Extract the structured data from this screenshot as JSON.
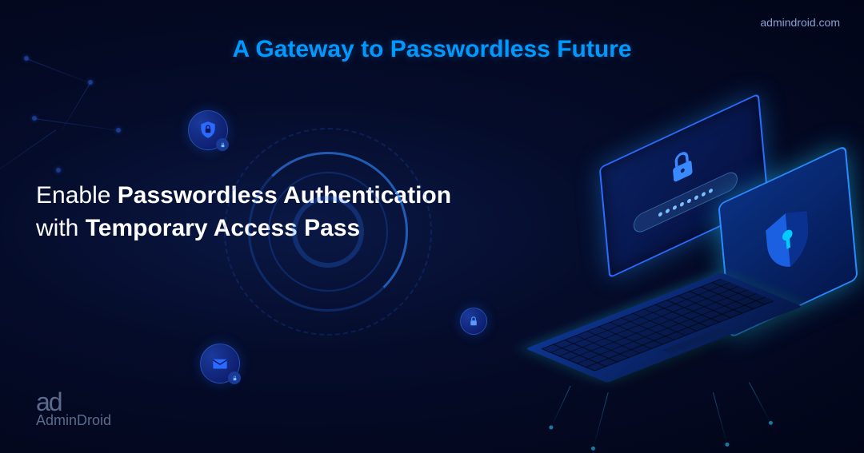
{
  "brand": {
    "url": "admindroid.com",
    "name": "AdminDroid",
    "glyph": "ad"
  },
  "tagline": "A Gateway to Passwordless Future",
  "headline": {
    "line1_pre": "Enable ",
    "line1_strong": "Passwordless Authentication",
    "line2_pre": "with ",
    "line2_strong": "Temporary Access Pass"
  },
  "icons": {
    "shield_lock": "shield with lock",
    "envelope_lock": "envelope with lock",
    "lock": "padlock",
    "shield_key": "shield with keyhole"
  }
}
